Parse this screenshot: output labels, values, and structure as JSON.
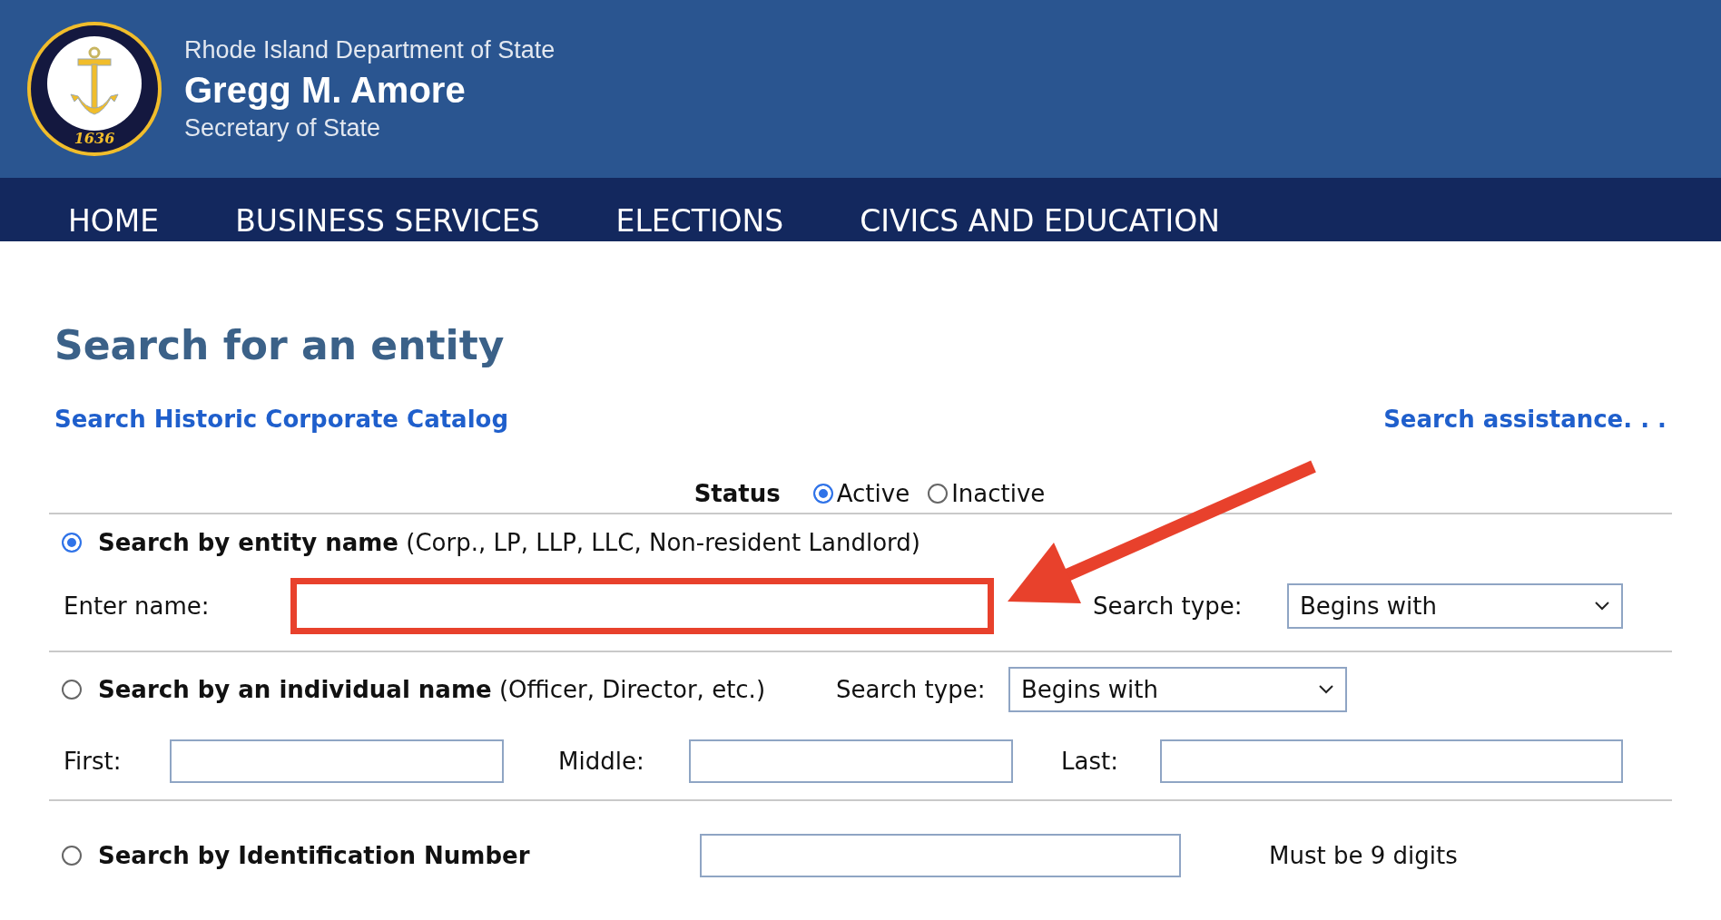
{
  "header": {
    "department": "Rhode Island Department of State",
    "name": "Gregg M. Amore",
    "subtitle": "Secretary of State",
    "seal_year": "1636"
  },
  "nav": [
    {
      "label": "HOME"
    },
    {
      "label": "BUSINESS SERVICES"
    },
    {
      "label": "ELECTIONS"
    },
    {
      "label": "CIVICS AND EDUCATION"
    }
  ],
  "page_title": "Search for an entity",
  "links": [
    {
      "label": "Search Historic Corporate Catalog"
    },
    {
      "label": "Search assistance. . ."
    }
  ],
  "status": {
    "label": "Status",
    "options": [
      {
        "label": "Active",
        "selected": true
      },
      {
        "label": "Inactive",
        "selected": false
      }
    ]
  },
  "sections": [
    {
      "kind": "entity",
      "selected": true,
      "title": "Search by entity name",
      "note": "(Corp., LP, LLP, LLC, Non-resident Landlord)",
      "fields": [
        {
          "label": "Enter name:",
          "highlighted": true
        }
      ],
      "search_type": {
        "label": "Search type:",
        "value": "Begins with"
      }
    },
    {
      "kind": "individual",
      "selected": false,
      "title": "Search by an individual name",
      "note": "(Officer, Director, etc.)",
      "search_type": {
        "label": "Search type:",
        "value": "Begins with"
      },
      "fields": [
        {
          "label": "First:",
          "highlighted": false
        },
        {
          "label": "Middle:",
          "highlighted": false
        },
        {
          "label": "Last:",
          "highlighted": false
        }
      ]
    },
    {
      "kind": "id",
      "selected": false,
      "title": "Search by Identification Number",
      "fields": [
        {
          "highlighted": false
        }
      ],
      "hint": "Must be 9 digits"
    }
  ],
  "annotations": [
    {
      "kind": "arrow",
      "color": "#e8412c"
    }
  ]
}
